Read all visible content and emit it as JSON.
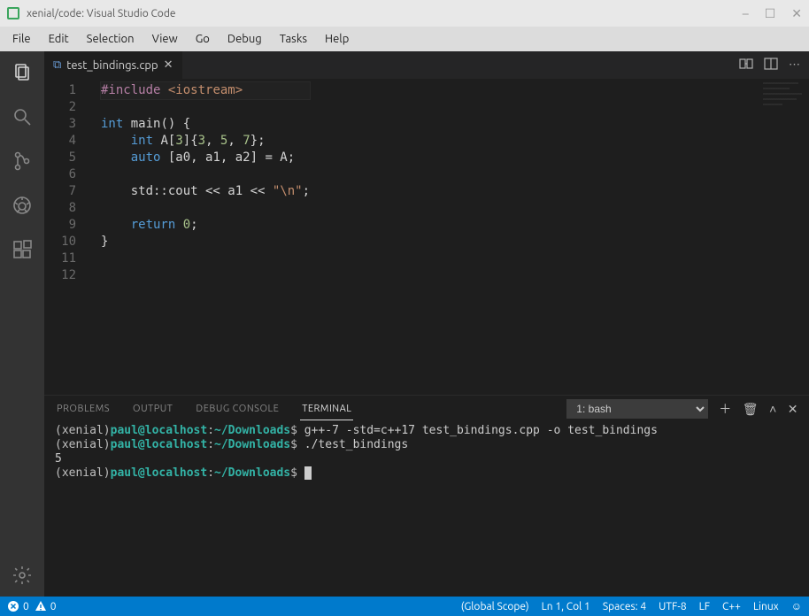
{
  "window": {
    "title": "xenial/code: Visual Studio Code"
  },
  "menu": [
    "File",
    "Edit",
    "Selection",
    "View",
    "Go",
    "Debug",
    "Tasks",
    "Help"
  ],
  "tabs": [
    {
      "label": "test_bindings.cpp"
    }
  ],
  "code_lines": [
    {
      "n": 1,
      "html": "<span class='tok-include'>#include</span> <span class='tok-header'>&lt;iostream&gt;</span>"
    },
    {
      "n": 2,
      "html": ""
    },
    {
      "n": 3,
      "html": "<span class='tok-type'>int</span> <span class='tok-id'>main</span><span class='tok-punct'>() {</span>"
    },
    {
      "n": 4,
      "html": "    <span class='tok-type'>int</span> <span class='tok-id'>A</span><span class='tok-punct'>[</span><span class='tok-num'>3</span><span class='tok-punct'>]{</span><span class='tok-num'>3</span><span class='tok-punct'>, </span><span class='tok-num'>5</span><span class='tok-punct'>, </span><span class='tok-num'>7</span><span class='tok-punct'>};</span>"
    },
    {
      "n": 5,
      "html": "    <span class='tok-kw'>auto</span> <span class='tok-punct'>[a0, a1, a2] = A;</span>"
    },
    {
      "n": 6,
      "html": ""
    },
    {
      "n": 7,
      "html": "    <span class='tok-id'>std::cout &lt;&lt; a1 &lt;&lt; </span><span class='tok-str'>\"\\n\"</span><span class='tok-punct'>;</span>"
    },
    {
      "n": 8,
      "html": ""
    },
    {
      "n": 9,
      "html": "    <span class='tok-kw'>return</span> <span class='tok-num'>0</span><span class='tok-punct'>;</span>"
    },
    {
      "n": 10,
      "html": "<span class='tok-punct'>}</span>"
    },
    {
      "n": 11,
      "html": ""
    },
    {
      "n": 12,
      "html": ""
    }
  ],
  "panel": {
    "tabs": [
      "PROBLEMS",
      "OUTPUT",
      "DEBUG CONSOLE",
      "TERMINAL"
    ],
    "active": "TERMINAL",
    "select": "1: bash"
  },
  "terminal": {
    "prompt_prefix": "(xenial)",
    "prompt_user": "paul@localhost",
    "prompt_sep": ":",
    "prompt_dir": "~/Downloads",
    "prompt_suffix": "$",
    "lines": [
      {
        "cmd": "g++-7 -std=c++17 test_bindings.cpp -o test_bindings"
      },
      {
        "cmd": "./test_bindings"
      },
      {
        "out": "5"
      },
      {
        "cmd": "",
        "cursor": true
      }
    ]
  },
  "status": {
    "errors": "0",
    "warnings": "0",
    "scope": "(Global Scope)",
    "cursor": "Ln 1, Col 1",
    "spaces": "Spaces: 4",
    "encoding": "UTF-8",
    "eol": "LF",
    "lang": "C++",
    "os": "Linux"
  }
}
